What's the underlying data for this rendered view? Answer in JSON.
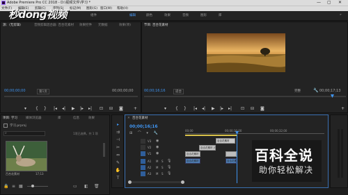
{
  "titlebar": {
    "title": "Adobe Premiere Pro CC 2018 - D:\\视频文件\\学习 *",
    "min": "—",
    "max": "▢",
    "close": "✕"
  },
  "menu": [
    "文件(F)",
    "编辑(E)",
    "剪辑(C)",
    "序列(S)",
    "标记(M)",
    "图形(G)",
    "窗口(W)",
    "帮助(H)"
  ],
  "workspaces": [
    "组件",
    "编辑",
    "颜色",
    "效果",
    "音频",
    "图形",
    "库"
  ],
  "watermark": "秒dong视频",
  "source": {
    "tabs": [
      "源：(无剪辑)",
      "音频剪辑混合器: 百合花素材",
      "效果控件",
      "元数据",
      "效果(项)"
    ],
    "timecode_left": "00;00;00;00",
    "page": "第1页",
    "timecode_right": "00;00;00;00"
  },
  "program": {
    "tabs": [
      "节目: 百合花素材"
    ],
    "timecode_left": "00;00;16;16",
    "fit": "适合",
    "quality": "完整",
    "timecode_right": "00;00;17;13"
  },
  "project": {
    "tabs": [
      "项目: 学习",
      "媒体浏览器",
      "库",
      "信息",
      "效果"
    ],
    "name": "学习.prproj",
    "count": "1项已选择，共 1 项",
    "clip_name": "百合花素材",
    "clip_duration": "17;13"
  },
  "timeline": {
    "tab": "百合花素材",
    "timecode": "00;00;16;16",
    "ruler": [
      "00;00",
      "00;00;16;00",
      "00;00;32;00"
    ],
    "video_tracks": [
      "V3",
      "V2",
      "V1"
    ],
    "audio_tracks": [
      "A1",
      "A2",
      "A3"
    ],
    "clips_v": [
      "百合花素材",
      "百合花素材 [V]",
      "百合花素材"
    ],
    "clips_a": [
      "百合花素材",
      "百合花素材"
    ]
  },
  "baike": {
    "title": "百科全说",
    "subtitle": "助你轻松解决"
  },
  "colors": {
    "accent": "#3f94f0",
    "bg": "#232323",
    "ws_active": "#4a9bf7"
  }
}
